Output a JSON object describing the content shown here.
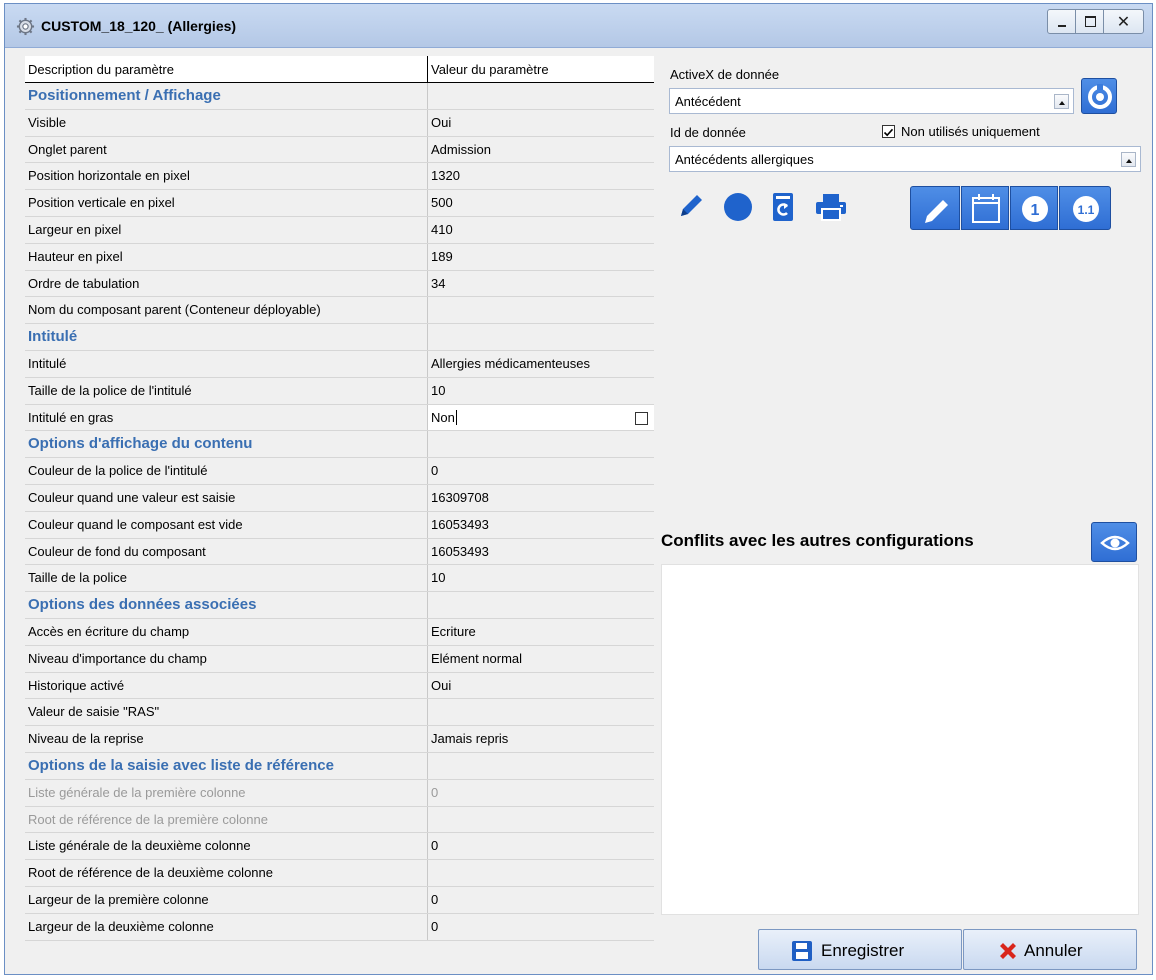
{
  "window": {
    "title": "CUSTOM_18_120_ (Allergies)"
  },
  "grid": {
    "col_description": "Description du paramètre",
    "col_value": "Valeur du paramètre",
    "rows": [
      {
        "label": "Positionnement / Affichage",
        "value": "",
        "type": "section"
      },
      {
        "label": "Visible",
        "value": "Oui"
      },
      {
        "label": "Onglet parent",
        "value": "Admission"
      },
      {
        "label": "Position horizontale en pixel",
        "value": "1320"
      },
      {
        "label": "Position verticale en pixel",
        "value": "500"
      },
      {
        "label": "Largeur en pixel",
        "value": "410"
      },
      {
        "label": "Hauteur en pixel",
        "value": "189"
      },
      {
        "label": "Ordre de tabulation",
        "value": "34"
      },
      {
        "label": "Nom du composant parent (Conteneur déployable)",
        "value": ""
      },
      {
        "label": "Intitulé",
        "value": "",
        "type": "section"
      },
      {
        "label": "Intitulé",
        "value": "Allergies médicamenteuses"
      },
      {
        "label": "Taille de la police de l'intitulé",
        "value": "10"
      },
      {
        "label": "Intitulé en gras",
        "value": "Non",
        "type": "editing"
      },
      {
        "label": "Options d'affichage du contenu",
        "value": "",
        "type": "section"
      },
      {
        "label": "Couleur de la police de l'intitulé",
        "value": "0"
      },
      {
        "label": "Couleur quand une valeur est saisie",
        "value": "16309708"
      },
      {
        "label": "Couleur quand le composant est vide",
        "value": "16053493"
      },
      {
        "label": "Couleur de fond du composant",
        "value": "16053493"
      },
      {
        "label": "Taille de la police",
        "value": "10"
      },
      {
        "label": "Options des données associées",
        "value": "",
        "type": "section"
      },
      {
        "label": "Accès en écriture du champ",
        "value": "Ecriture"
      },
      {
        "label": "Niveau d'importance du champ",
        "value": "Elément normal"
      },
      {
        "label": "Historique activé",
        "value": "Oui"
      },
      {
        "label": "Valeur de saisie \"RAS\"",
        "value": ""
      },
      {
        "label": "Niveau de la reprise",
        "value": "Jamais repris"
      },
      {
        "label": "Options de la saisie avec liste de référence",
        "value": "",
        "type": "section"
      },
      {
        "label": "Liste générale de la première colonne",
        "value": "0",
        "type": "disabled"
      },
      {
        "label": "Root de référence de la première colonne",
        "value": "",
        "type": "disabled"
      },
      {
        "label": "Liste générale de la deuxième colonne",
        "value": "0"
      },
      {
        "label": "Root de référence de la deuxième colonne",
        "value": ""
      },
      {
        "label": "Largeur de la première colonne",
        "value": "0"
      },
      {
        "label": "Largeur de la deuxième colonne",
        "value": "0"
      }
    ]
  },
  "activex": {
    "label": "ActiveX de donnée",
    "value": "Antécédent"
  },
  "data_id": {
    "label": "Id de donnée",
    "value": "Antécédents allergiques",
    "unused_only_label": "Non utilisés uniquement",
    "unused_only_checked": true
  },
  "conflicts": {
    "title": "Conflits avec les autres configurations"
  },
  "icons": {
    "number_one": "1",
    "number_one_one": "1.1"
  },
  "actions": {
    "save_label": "Enregistrer",
    "cancel_label": "Annuler"
  },
  "colors": {
    "accent_blue": "#2f6ed4",
    "section_text": "#3a6fb2",
    "cancel_red": "#d9261c"
  }
}
